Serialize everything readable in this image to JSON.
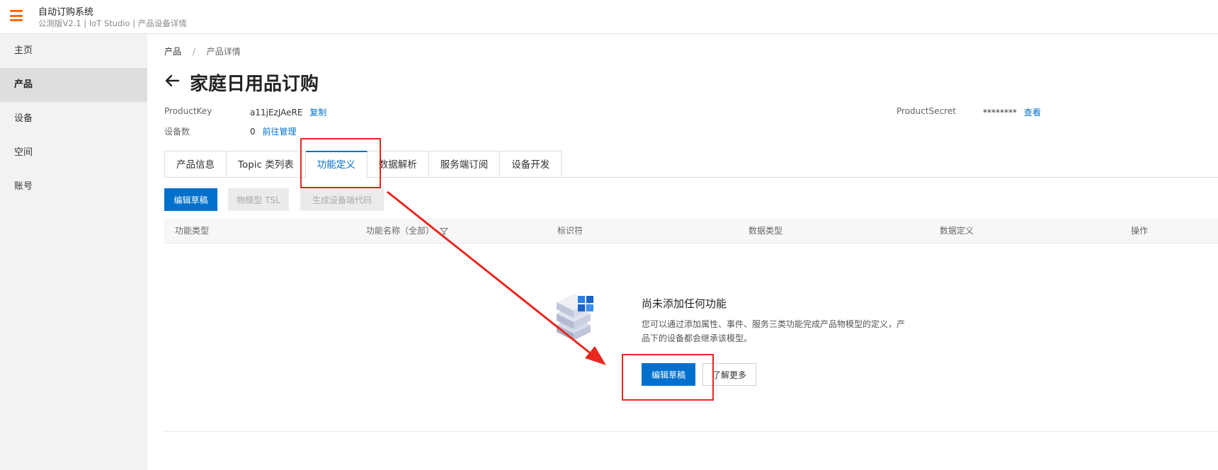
{
  "header": {
    "title": "自动订购系统",
    "subtitle": "公测版V2.1 | IoT Studio | 产品设备详情",
    "menu_icon": "hamburger-icon",
    "accent_color": "#ff6a00"
  },
  "sidebar": {
    "items": [
      {
        "label": "主页",
        "active": false
      },
      {
        "label": "产品",
        "active": true
      },
      {
        "label": "设备",
        "active": false
      },
      {
        "label": "空间",
        "active": false
      },
      {
        "label": "账号",
        "active": false
      }
    ]
  },
  "breadcrumb": {
    "items": [
      "产品",
      "产品详情"
    ],
    "separator": "/"
  },
  "page": {
    "title": "家庭日用品订购",
    "back_icon": "arrow-left-icon"
  },
  "meta": {
    "product_key_label": "ProductKey",
    "product_key_value": "a11jEzJAeRE",
    "copy_link": "复制",
    "device_count_label": "设备数",
    "device_count_value": "0",
    "manage_link": "前往管理",
    "product_secret_label": "ProductSecret",
    "product_secret_value": "********",
    "view_link": "查看"
  },
  "tabs": [
    {
      "label": "产品信息",
      "active": false
    },
    {
      "label": "Topic 类列表",
      "active": false
    },
    {
      "label": "功能定义",
      "active": true
    },
    {
      "label": "数据解析",
      "active": false
    },
    {
      "label": "服务端订阅",
      "active": false
    },
    {
      "label": "设备开发",
      "active": false
    }
  ],
  "toolbar": {
    "edit_draft": "编辑草稿",
    "tsl_model": "物模型 TSL",
    "generate_code": "生成设备端代码"
  },
  "table": {
    "columns": [
      "功能类型",
      "功能名称（全部）",
      "标识符",
      "数据类型",
      "数据定义",
      "操作"
    ],
    "filter_icon": "filter-icon"
  },
  "empty_state": {
    "title": "尚未添加任何功能",
    "description": "您可以通过添加属性、事件、服务三类功能完成产品物模型的定义，产品下的设备都会继承该模型。",
    "primary_button": "编辑草稿",
    "secondary_button": "了解更多",
    "icon": "server-stack-icon"
  },
  "colors": {
    "primary": "#0070cc",
    "annotation": "#e8271e"
  }
}
